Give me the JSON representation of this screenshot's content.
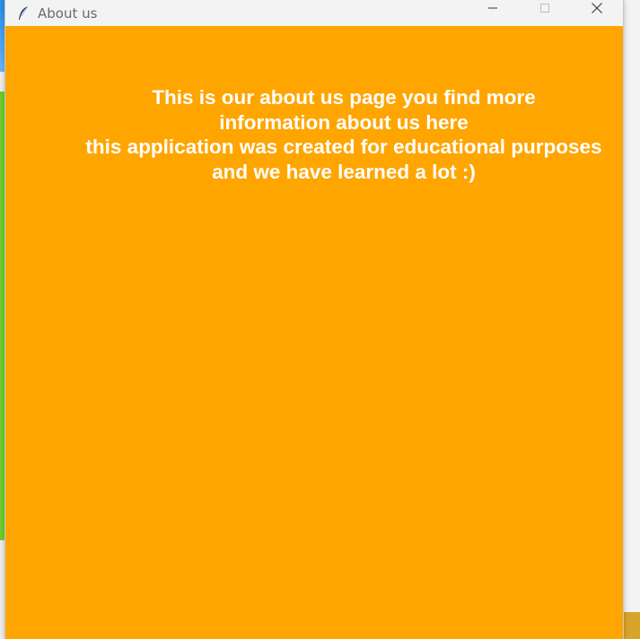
{
  "window": {
    "title": "About us",
    "background_color": "#ffa500",
    "text_color": "#ffffff",
    "controls": {
      "minimize_icon": "minimize-icon",
      "maximize_icon": "maximize-icon",
      "close_icon": "close-icon"
    }
  },
  "about": {
    "lines": [
      "This is our about us page you find more",
      "information about us here",
      "this application was created for educational purposes",
      "and we have learned a lot :)"
    ]
  }
}
